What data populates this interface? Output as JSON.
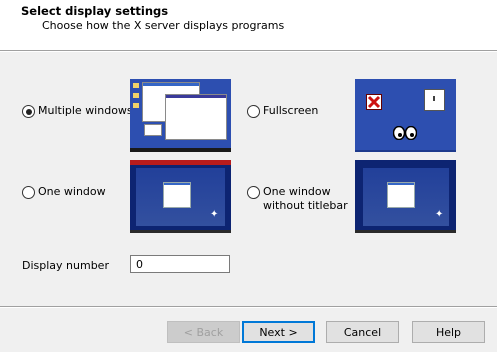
{
  "header": {
    "title": "Select display settings",
    "subtitle": "Choose how the X server displays programs"
  },
  "options": [
    {
      "label": "Multiple windows",
      "checked": true
    },
    {
      "label": "Fullscreen",
      "checked": false
    },
    {
      "label": "One window",
      "checked": false
    },
    {
      "label": "One window\nwithout titlebar",
      "checked": false
    }
  ],
  "display_number": {
    "label": "Display number",
    "value": "0"
  },
  "buttons": {
    "back": "< Back",
    "next": "Next >",
    "cancel": "Cancel",
    "help": "Help"
  },
  "colors": {
    "desktop_blue": "#2d4fb0",
    "accent": "#0078d7"
  },
  "icons": {
    "fullscreen_thumb": [
      "x-logo-icon",
      "clock-icon",
      "xeyes-icon"
    ]
  }
}
